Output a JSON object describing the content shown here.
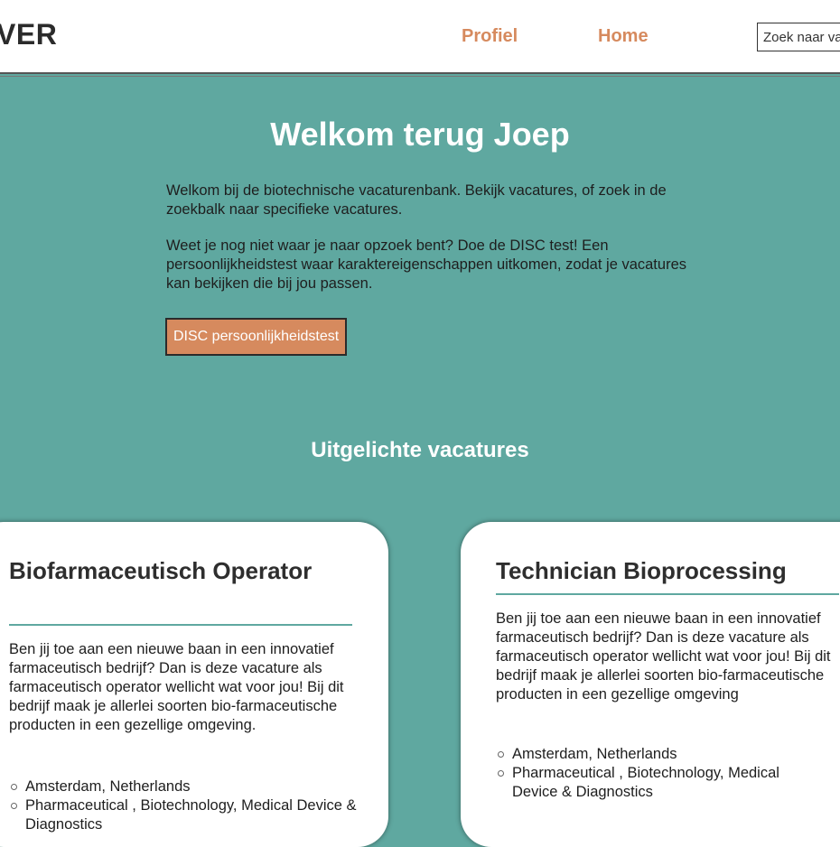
{
  "header": {
    "logo": "VER",
    "nav": {
      "profile": "Profiel",
      "home": "Home"
    },
    "search": {
      "placeholder": "Zoek naar vacatures"
    }
  },
  "hero": {
    "title": "Welkom terug Joep",
    "paragraph1": "Welkom bij de biotechnische vacaturenbank. Bekijk vacatures, of zoek in de zoekbalk naar specifieke vacatures.",
    "paragraph2": "Weet je nog niet waar je naar opzoek bent? Doe de DISC test! Een persoonlijkheidstest waar karaktereigenschappen uitkomen, zodat je vacatures kan bekijken die bij jou passen.",
    "disc_button": "DISC persoonlijkheidstest"
  },
  "featured": {
    "title": "Uitgelichte vacatures",
    "jobs": [
      {
        "title": "Biofarmaceutisch Operator",
        "description": "Ben jij toe aan een nieuwe baan in een innovatief farmaceutisch bedrijf? Dan is deze vacature als farmaceutisch operator wellicht wat voor jou! Bij dit bedrijf maak je allerlei soorten bio-farmaceutische producten in een gezellige omgeving.",
        "location": "Amsterdam, Netherlands",
        "sectors": "Pharmaceutical , Biotechnology, Medical Device & Diagnostics"
      },
      {
        "title": "Technician Bioprocessing",
        "description": "Ben jij toe aan een nieuwe baan in een innovatief farmaceutisch bedrijf? Dan is deze vacature als farmaceutisch operator wellicht wat voor jou! Bij dit bedrijf maak je allerlei soorten bio-farmaceutische producten in een gezellige omgeving",
        "location": "Amsterdam, Netherlands",
        "sectors": "Pharmaceutical , Biotechnology, Medical Device & Diagnostics"
      }
    ]
  },
  "colors": {
    "background": "#5fa8a0",
    "accent": "#d68a5e",
    "card": "#ffffff"
  }
}
